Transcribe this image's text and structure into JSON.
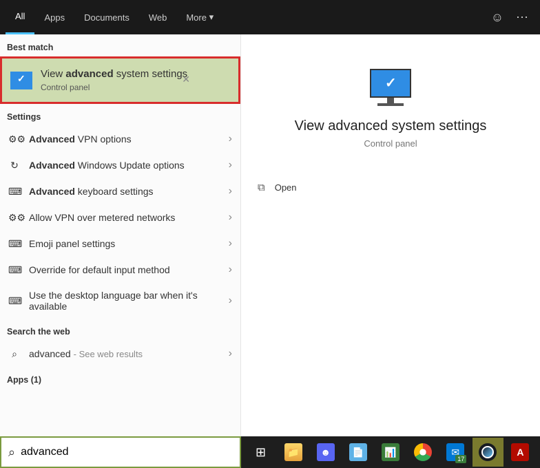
{
  "tabs": {
    "all": "All",
    "apps": "Apps",
    "documents": "Documents",
    "web": "Web",
    "more": "More"
  },
  "sections": {
    "best_match": "Best match",
    "settings": "Settings",
    "search_web": "Search the web",
    "apps": "Apps (1)"
  },
  "best_match": {
    "title_pre": "View ",
    "title_bold": "advanced",
    "title_post": " system settings",
    "subtitle": "Control panel"
  },
  "settings_items": [
    {
      "icon": "⚙⚙",
      "bold": "Advanced",
      "rest": " VPN options"
    },
    {
      "icon": "↻",
      "bold": "Advanced",
      "rest": " Windows Update options"
    },
    {
      "icon": "⌨",
      "bold": "Advanced",
      "rest": " keyboard settings"
    },
    {
      "icon": "⚙⚙",
      "bold": "",
      "rest": "Allow VPN over metered networks"
    },
    {
      "icon": "⌨",
      "bold": "",
      "rest": "Emoji panel settings"
    },
    {
      "icon": "⌨",
      "bold": "",
      "rest": "Override for default input method"
    },
    {
      "icon": "⌨",
      "bold": "",
      "rest": "Use the desktop language bar when it's available"
    }
  ],
  "web_search": {
    "query": "advanced",
    "hint": "See web results"
  },
  "preview": {
    "title": "View advanced system settings",
    "subtitle": "Control panel",
    "open": "Open"
  },
  "search_box": {
    "value": "advanced"
  },
  "taskbar_mail_badge": "17"
}
